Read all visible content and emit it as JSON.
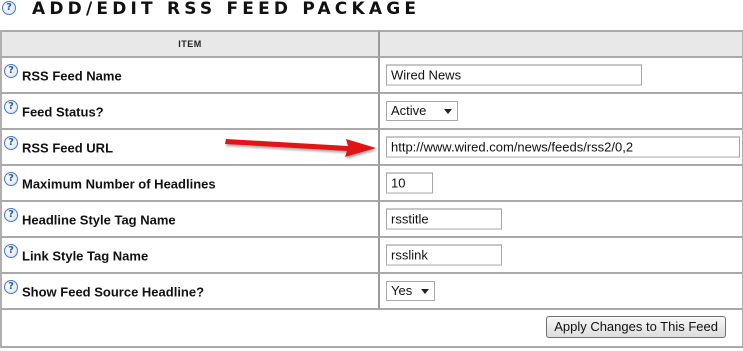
{
  "page": {
    "title": "ADD/EDIT RSS FEED PACKAGE"
  },
  "table": {
    "header": {
      "item_label": "ITEM",
      "value_label": ""
    },
    "rows": [
      {
        "label": "RSS Feed Name",
        "control": "text",
        "value": "Wired News"
      },
      {
        "label": "Feed Status?",
        "control": "select",
        "value": "Active"
      },
      {
        "label": "RSS Feed URL",
        "control": "text",
        "value": "http://www.wired.com/news/feeds/rss2/0,2"
      },
      {
        "label": "Maximum Number of Headlines",
        "control": "text",
        "value": "10"
      },
      {
        "label": "Headline Style Tag Name",
        "control": "text",
        "value": "rsstitle"
      },
      {
        "label": "Link Style Tag Name",
        "control": "text",
        "value": "rsslink"
      },
      {
        "label": "Show Feed Source Headline?",
        "control": "select",
        "value": "Yes"
      }
    ]
  },
  "actions": {
    "apply_label": "Apply Changes to This Feed"
  },
  "icons": {
    "help": "help-question-icon",
    "annotation": "red-arrow-icon"
  },
  "colors": {
    "border": "#a9a9a9",
    "header_bg": "#e8e8e8",
    "annotation_arrow": "#e01818",
    "help_icon": "#4a78c0"
  }
}
